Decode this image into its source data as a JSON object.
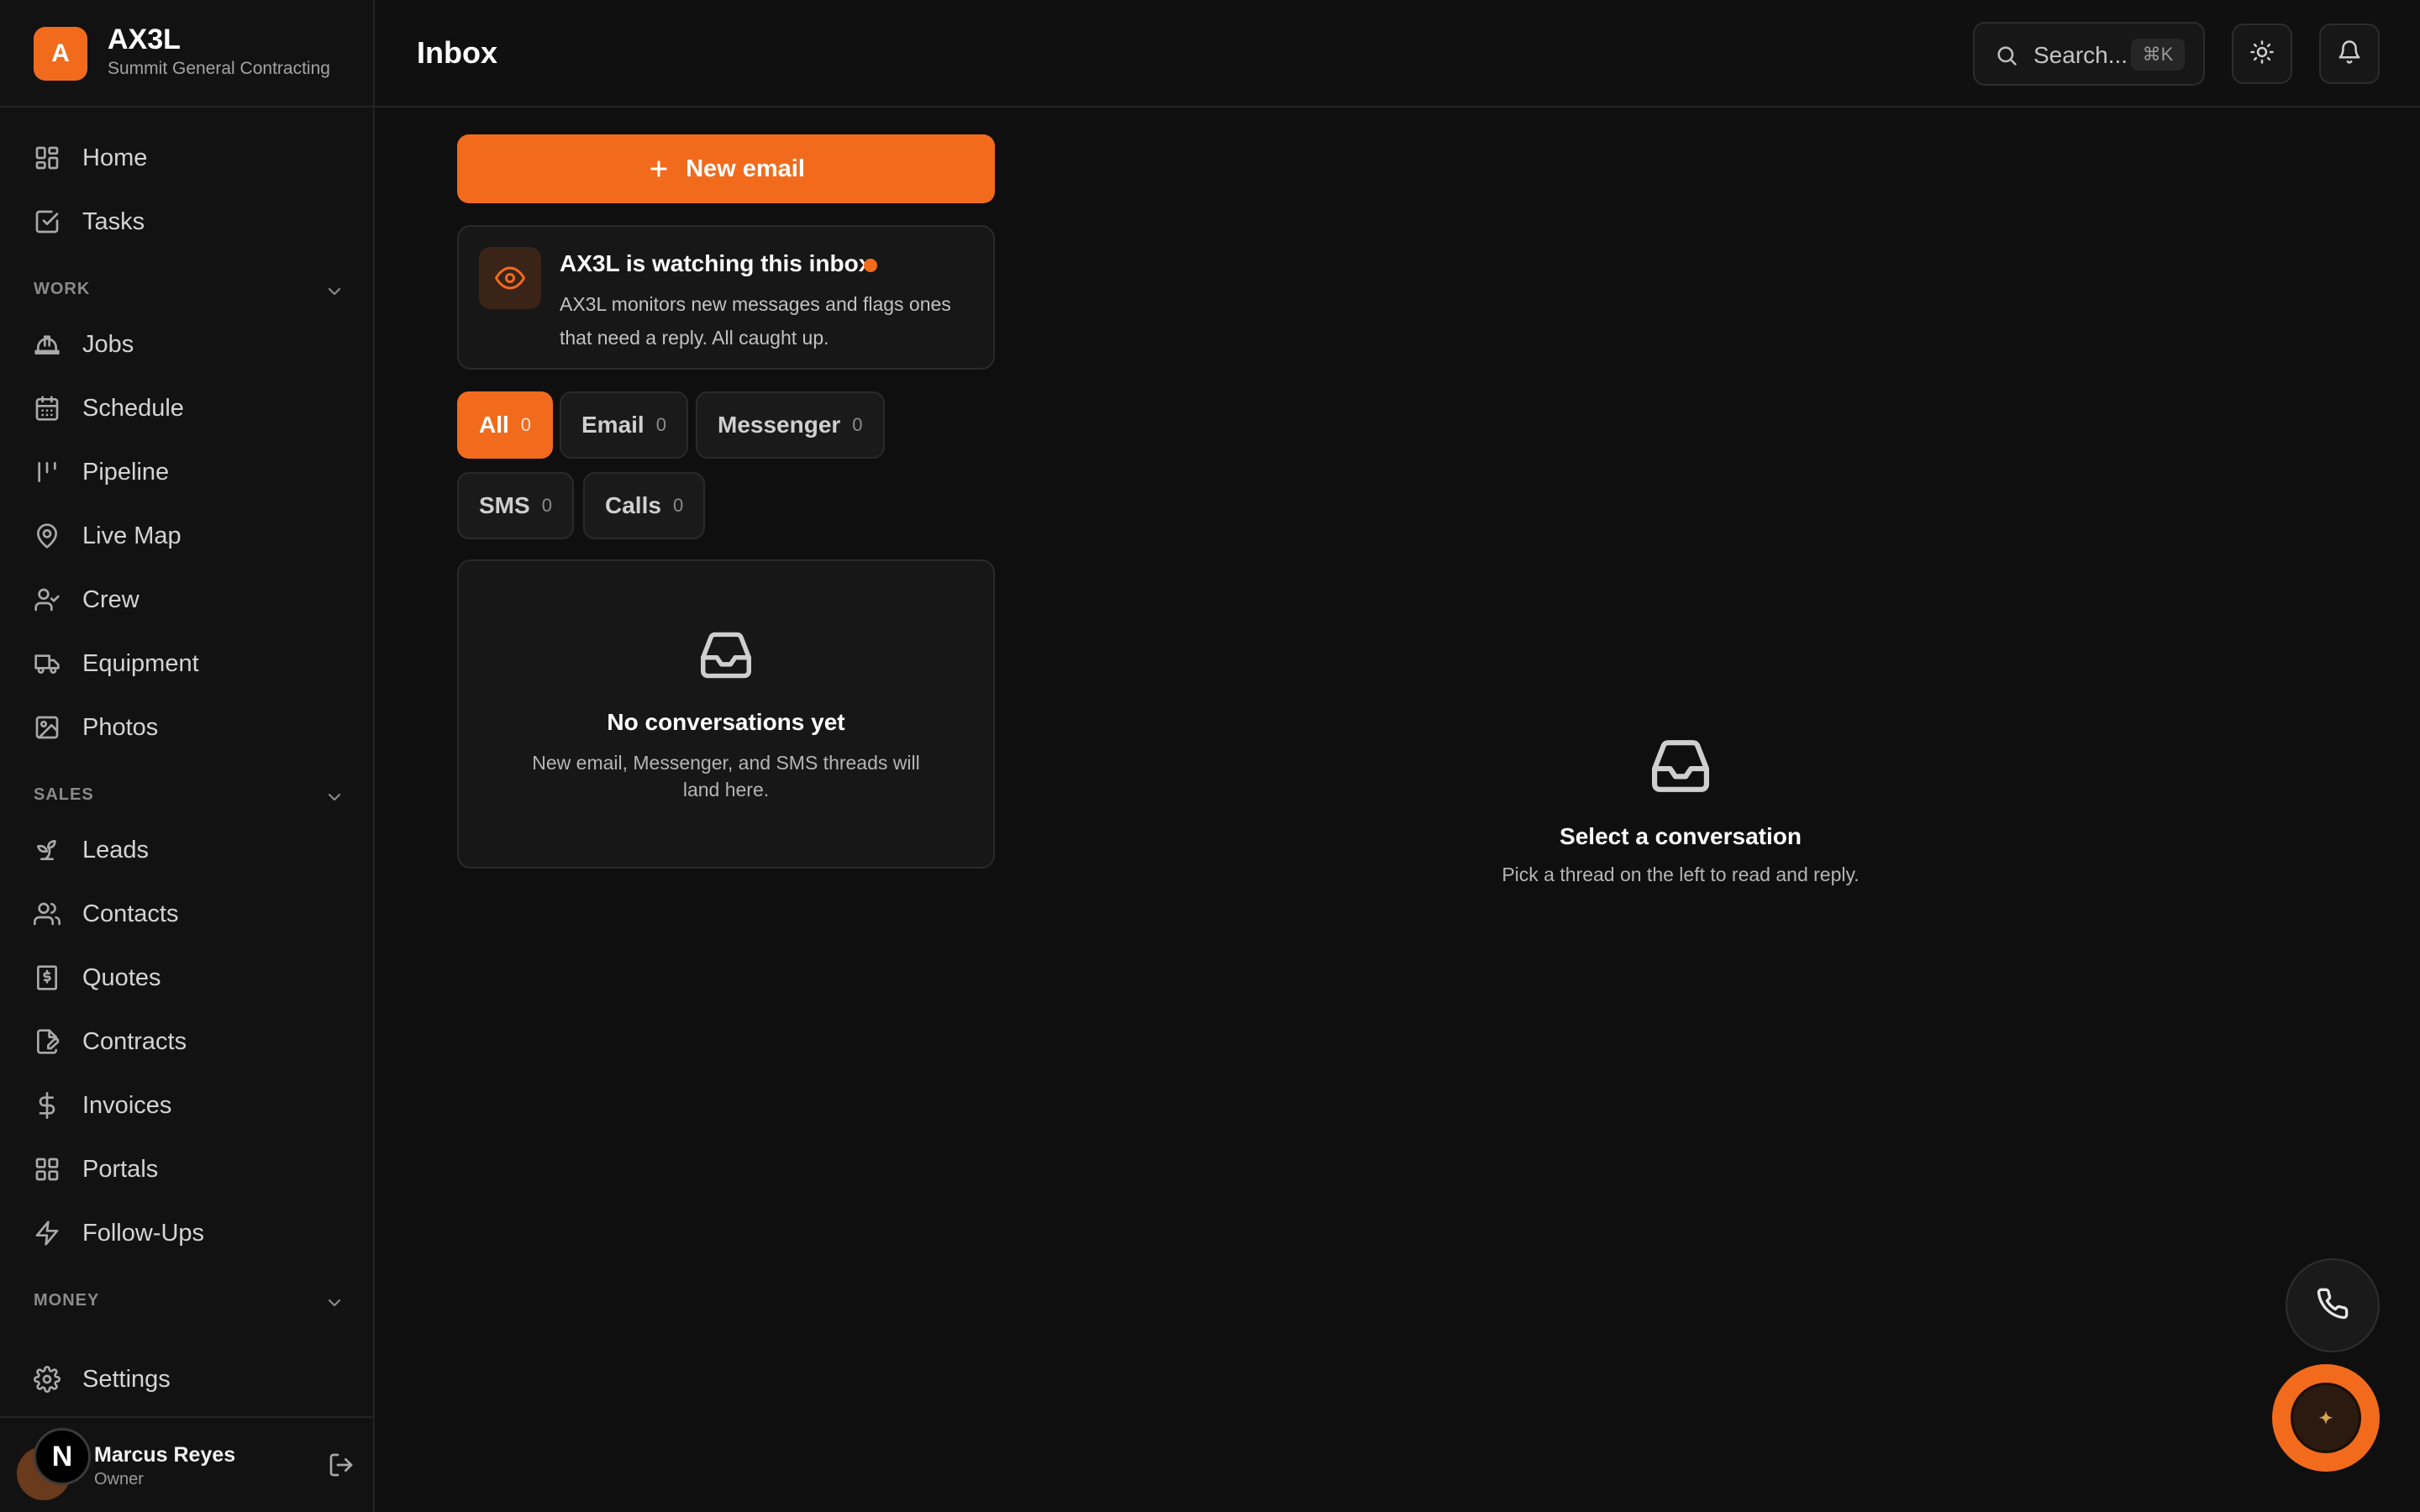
{
  "brand": {
    "logo_letter": "A",
    "name": "AX3L",
    "subtitle": "Summit General Contracting"
  },
  "sidebar": {
    "top_items": [
      {
        "label": "Home",
        "icon": "grid-icon"
      },
      {
        "label": "Tasks",
        "icon": "checkbox-icon"
      }
    ],
    "sections": [
      {
        "title": "WORK",
        "items": [
          {
            "label": "Jobs",
            "icon": "hard-hat-icon"
          },
          {
            "label": "Schedule",
            "icon": "calendar-icon"
          },
          {
            "label": "Pipeline",
            "icon": "kanban-icon"
          },
          {
            "label": "Live Map",
            "icon": "map-pin-icon"
          },
          {
            "label": "Crew",
            "icon": "user-check-icon"
          },
          {
            "label": "Equipment",
            "icon": "truck-icon"
          },
          {
            "label": "Photos",
            "icon": "image-icon"
          }
        ]
      },
      {
        "title": "SALES",
        "items": [
          {
            "label": "Leads",
            "icon": "sprout-icon"
          },
          {
            "label": "Contacts",
            "icon": "users-icon"
          },
          {
            "label": "Quotes",
            "icon": "receipt-icon"
          },
          {
            "label": "Contracts",
            "icon": "file-signature-icon"
          },
          {
            "label": "Invoices",
            "icon": "dollar-icon"
          },
          {
            "label": "Portals",
            "icon": "grid-icon"
          },
          {
            "label": "Follow-Ups",
            "icon": "zap-icon"
          }
        ]
      },
      {
        "title": "MONEY",
        "items": []
      }
    ],
    "settings_label": "Settings",
    "user": {
      "initial": "N",
      "name": "Marcus Reyes",
      "role": "Owner"
    }
  },
  "header": {
    "title": "Inbox",
    "search_placeholder": "Search...",
    "search_shortcut": "⌘K"
  },
  "inbox": {
    "new_email_label": "New email",
    "watch": {
      "title": "AX3L is watching this inbox",
      "description": "AX3L monitors new messages and flags ones that need a reply. All caught up."
    },
    "filters": [
      {
        "label": "All",
        "count": "0",
        "active": true
      },
      {
        "label": "Email",
        "count": "0",
        "active": false
      },
      {
        "label": "Messenger",
        "count": "0",
        "active": false
      },
      {
        "label": "SMS",
        "count": "0",
        "active": false
      },
      {
        "label": "Calls",
        "count": "0",
        "active": false
      }
    ],
    "empty": {
      "title": "No conversations yet",
      "description": "New email, Messenger, and SMS threads will land here."
    }
  },
  "detail": {
    "title": "Select a conversation",
    "description": "Pick a thread on the left to read and reply."
  },
  "colors": {
    "accent": "#f26b1d",
    "background": "#0f0f0f",
    "panel": "#171717"
  }
}
